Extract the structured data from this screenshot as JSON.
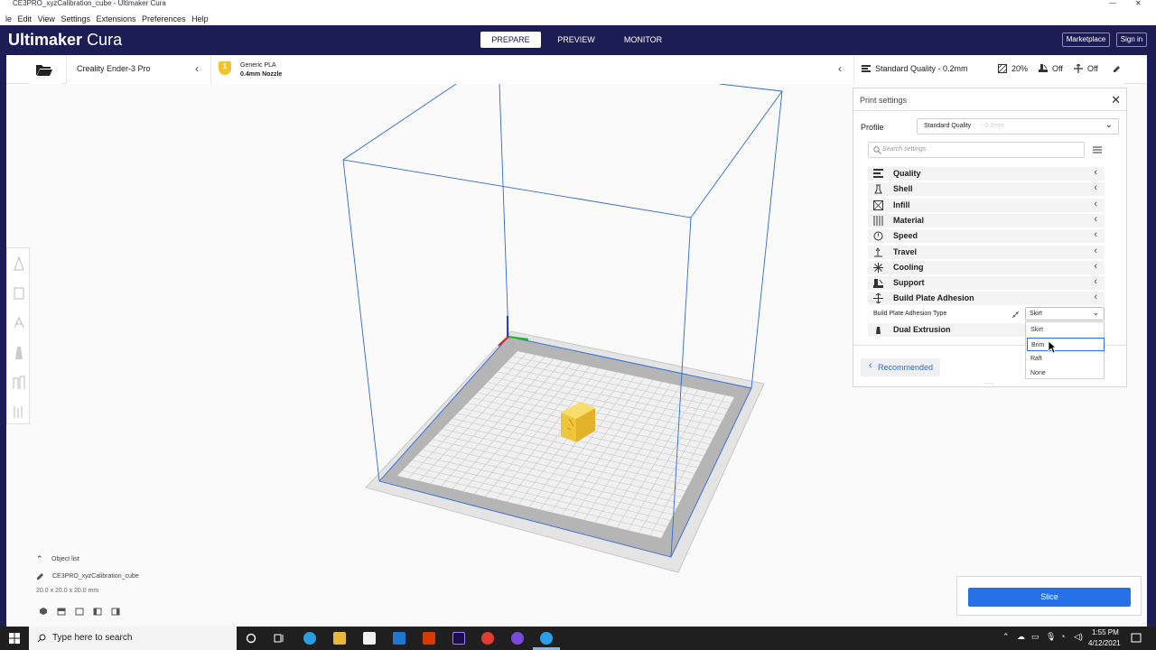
{
  "window": {
    "title": "CE3PRO_xyzCalibration_cube - Ultimaker Cura",
    "controls": {
      "minimize": "—",
      "maximize": "☐",
      "close": "✕"
    }
  },
  "menu": [
    "le",
    "Edit",
    "View",
    "Settings",
    "Extensions",
    "Preferences",
    "Help"
  ],
  "header": {
    "logo_bold": "Ultimaker",
    "logo_light": "Cura",
    "stages": [
      "PREPARE",
      "PREVIEW",
      "MONITOR"
    ],
    "active_stage": "PREPARE",
    "marketplace": "Marketplace",
    "sign_in": "Sign in",
    "bg_color": "#1c1d54"
  },
  "toolbar": {
    "printer": "Creality Ender-3 Pro",
    "material_name": "Generic PLA",
    "nozzle": "0.4mm Nozzle",
    "extruder_number": "1",
    "quality": "Standard Quality - 0.2mm",
    "infill": "20%",
    "support": "Off",
    "adhesion": "Off"
  },
  "print_settings": {
    "title": "Print settings",
    "profile_label": "Profile",
    "profile_value": "Standard Quality",
    "profile_suffix": "- 0.2mm",
    "search_placeholder": "Search settings",
    "categories": [
      {
        "label": "Quality",
        "icon": "quality-icon"
      },
      {
        "label": "Shell",
        "icon": "shell-icon"
      },
      {
        "label": "Infill",
        "icon": "infill-icon"
      },
      {
        "label": "Material",
        "icon": "material-icon"
      },
      {
        "label": "Speed",
        "icon": "speed-icon"
      },
      {
        "label": "Travel",
        "icon": "travel-icon"
      },
      {
        "label": "Cooling",
        "icon": "cooling-icon"
      },
      {
        "label": "Support",
        "icon": "support-icon"
      },
      {
        "label": "Build Plate Adhesion",
        "icon": "adhesion-icon"
      }
    ],
    "adhesion_type_label": "Build Plate Adhesion Type",
    "adhesion_type_value": "Skirt",
    "dual_extrusion": "Dual Extrusion",
    "recommended": "Recommended",
    "dropdown_options": [
      "Skirt",
      "Brim",
      "Raft",
      "None"
    ],
    "highlighted_option": "Brim"
  },
  "object": {
    "list_label": "Object list",
    "name": "CE3PRO_xyzCalibration_cube",
    "dimensions": "20.0 x 20.0 x 20.0 mm"
  },
  "slice_label": "Slice",
  "taskbar": {
    "search_placeholder": "Type here to search",
    "time": "1:55 PM",
    "date": "4/12/2021"
  },
  "colors": {
    "accent": "#2670e8",
    "build_volume": "#2e6ad8",
    "cube": "#f2cf3a"
  }
}
